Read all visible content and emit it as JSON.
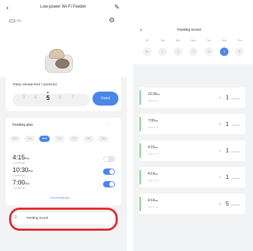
{
  "left": {
    "back": "‹",
    "title": "Low-power Wi-Fi Feeder",
    "edit": "✎",
    "battery": "8%",
    "gear": "⚙",
    "feed_today_prefix": "Today, already feed ",
    "feed_today_count": "7",
    "feed_today_suffix": " portion(s)",
    "portions": [
      "3",
      "4",
      "5",
      "6",
      "7"
    ],
    "portion_selected": "5",
    "feed_button": "Feed",
    "plan_title": "Feeding plan",
    "plan_arrow": "›",
    "days": [
      "Mon",
      "Tue",
      "Wed",
      "Thu",
      "Fri",
      "Sat",
      "Sun"
    ],
    "day_selected": "Wed",
    "plans": [
      {
        "time": "4:15",
        "ampm": "PM",
        "sub": "1 portion(s)",
        "on": false
      },
      {
        "time": "10:30",
        "ampm": "PM",
        "sub": "1 portion(s)",
        "on": true
      },
      {
        "time": "7:00",
        "ampm": "PM",
        "sub": "1 portion(s)",
        "on": true
      }
    ],
    "add_plan": "+ Add feeding plan",
    "record_icon": "☰",
    "record_label": "Feeding record",
    "record_arrow": "›"
  },
  "right": {
    "back": "‹",
    "title": "Feeding record",
    "week_days": [
      "Fri",
      "Sat",
      "Sun",
      "Mon",
      "Tue",
      "Wed",
      "Thu"
    ],
    "week_nums": [
      "31",
      "1",
      "2",
      "3",
      "4",
      "5",
      "6"
    ],
    "selected_num": "5",
    "entries": [
      {
        "time": "10:30",
        "ampm": "PM",
        "date": "2020-11-05",
        "amount": "1",
        "unit": "portion(s)"
      },
      {
        "time": "7:00",
        "ampm": "PM",
        "date": "2020-11-05",
        "amount": "1",
        "unit": "portion(s)"
      },
      {
        "time": "4:15",
        "ampm": "PM",
        "date": "2020-11-05",
        "amount": "1",
        "unit": "portion(s)"
      },
      {
        "time": "4:14",
        "ampm": "PM",
        "date": "2020-11-05",
        "amount": "1",
        "unit": "portion(s)"
      },
      {
        "time": "4:14",
        "ampm": "PM",
        "date": "2020-11-05",
        "amount": "5",
        "unit": "portion(s)"
      }
    ]
  },
  "colors": {
    "accent": "#4a86e8",
    "highlight": "#e02a2a",
    "record_bar": "#8ad18a"
  }
}
